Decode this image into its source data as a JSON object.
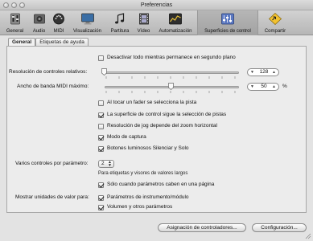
{
  "window": {
    "title": "Preferencias"
  },
  "toolbar": {
    "items": [
      {
        "label": "General",
        "icon": "gear-switch-icon"
      },
      {
        "label": "Audio",
        "icon": "audio-icon"
      },
      {
        "label": "MIDI",
        "icon": "midi-connector-icon"
      },
      {
        "label": "Visualización",
        "icon": "monitor-icon"
      },
      {
        "label": "Partitura",
        "icon": "music-notes-icon"
      },
      {
        "label": "Vídeo",
        "icon": "film-icon"
      },
      {
        "label": "Automatización",
        "icon": "automation-icon"
      },
      {
        "label": "Superficies de control",
        "icon": "control-surface-icon"
      },
      {
        "label": "Compartir",
        "icon": "share-icon"
      }
    ],
    "selected_index": 7
  },
  "tabs": [
    {
      "label": "General",
      "active": true
    },
    {
      "label": "Etiquetas de ayuda",
      "active": false
    }
  ],
  "general": {
    "disable_all": {
      "label": "Desactivar todo mientras permanece en segundo plano",
      "checked": false
    },
    "relative_resolution": {
      "label": "Resolución de controles relativos:",
      "value": "128",
      "level": 1.0
    },
    "midi_bandwidth": {
      "label": "Ancho de banda MIDI máximo:",
      "value": "50",
      "unit": "%",
      "level": 0.5
    },
    "options": [
      {
        "label": "Al tocar un fader se selecciona la pista",
        "checked": false
      },
      {
        "label": "La superficie de control sigue la selección de pistas",
        "checked": true
      },
      {
        "label": "Resolución de jog depende del zoom horizontal",
        "checked": false
      },
      {
        "label": "Modo de captura",
        "checked": true
      },
      {
        "label": "Botones luminosos Silenciar y Solo",
        "checked": true
      }
    ],
    "multi_controls": {
      "label": "Varios controles por parámetro:",
      "value": "2",
      "note": "Para etiquetas y visores de valores largos",
      "fit_page": {
        "label": "Sólo cuando parámetros caben en una página",
        "checked": true
      }
    },
    "value_units": {
      "label": "Mostrar unidades de valor para:",
      "options": [
        {
          "label": "Parámetros de instrumento/módulo",
          "checked": true
        },
        {
          "label": "Volumen y otros parámetros",
          "checked": true
        }
      ]
    }
  },
  "buttons": {
    "controller_assignments": "Asignación de controladores...",
    "setup": "Configuración..."
  }
}
